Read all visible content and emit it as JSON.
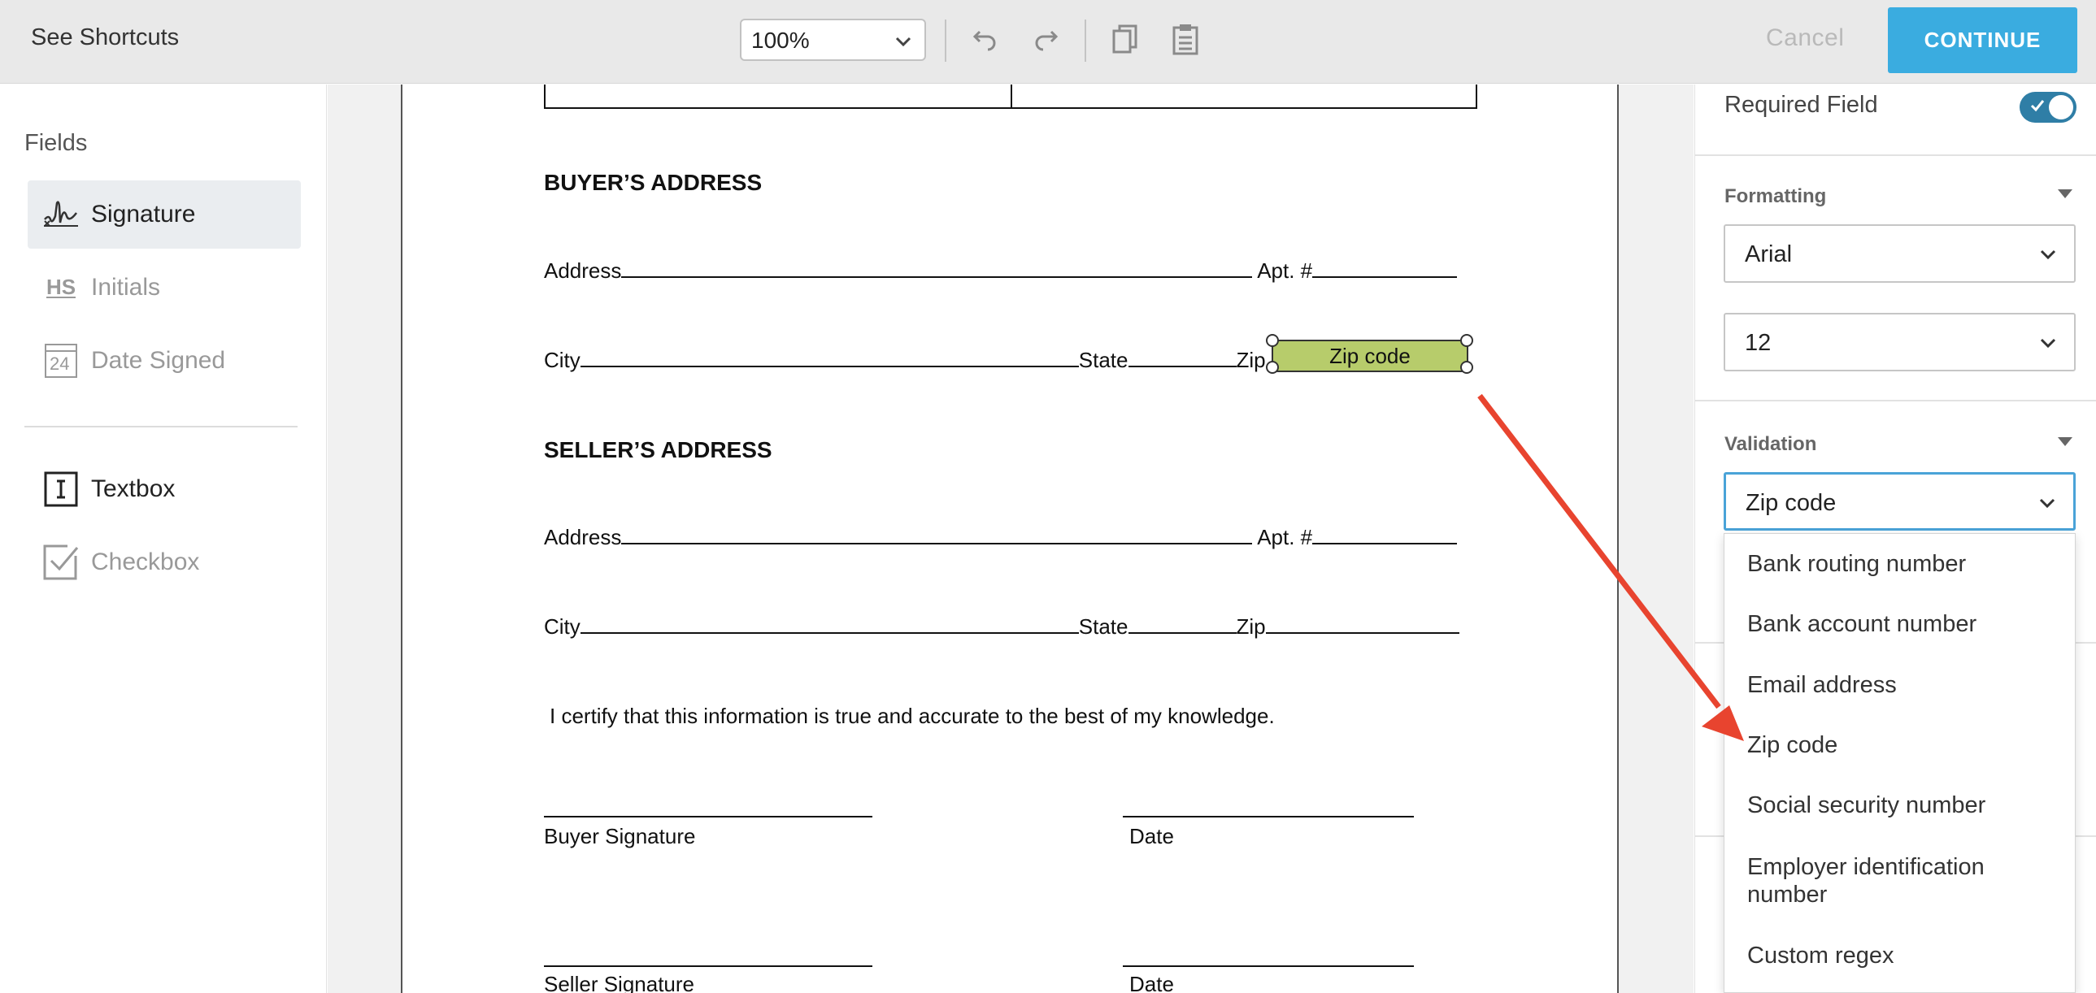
{
  "toolbar": {
    "shortcuts_label": "See Shortcuts",
    "zoom_value": "100%",
    "cancel_label": "Cancel",
    "continue_label": "CONTINUE",
    "icons": [
      "undo-icon",
      "redo-icon",
      "copy-icon",
      "paste-icon"
    ]
  },
  "left_panel": {
    "title": "Fields",
    "items": [
      {
        "label": "Signature",
        "icon": "signature-icon",
        "enabled": true,
        "active": true
      },
      {
        "label": "Initials",
        "icon": "initials-icon",
        "enabled": false
      },
      {
        "label": "Date Signed",
        "icon": "calendar-icon",
        "enabled": false
      },
      {
        "label": "Textbox",
        "icon": "textbox-icon",
        "enabled": true
      },
      {
        "label": "Checkbox",
        "icon": "checkbox-icon",
        "enabled": false
      }
    ],
    "initials_glyph": "HS",
    "date_glyph": "24"
  },
  "document": {
    "buyer_heading": "BUYER’S ADDRESS",
    "seller_heading": "SELLER’S ADDRESS",
    "address_label": "Address",
    "apt_label": "Apt. #",
    "city_label": "City",
    "state_label": "State",
    "zip_label": "Zip",
    "zip_field_label": "Zip code",
    "certify_text": "I certify that this information is true and accurate to the best of my knowledge.",
    "buyer_signature": "Buyer Signature",
    "seller_signature": "Seller Signature",
    "date_label": "Date"
  },
  "right_panel": {
    "required_label": "Required Field",
    "required_on": true,
    "formatting_title": "Formatting",
    "font_value": "Arial",
    "size_value": "12",
    "validation_title": "Validation",
    "validation_value": "Zip code",
    "options": [
      "Bank routing number",
      "Bank account number",
      "Email address",
      "Zip code",
      "Social security number",
      "Employer identification number",
      "Custom regex"
    ]
  },
  "colors": {
    "accent": "#3aace0",
    "toggle": "#2f7ea6",
    "zip_field": "#b7cc6b",
    "arrow": "#e8442f"
  }
}
